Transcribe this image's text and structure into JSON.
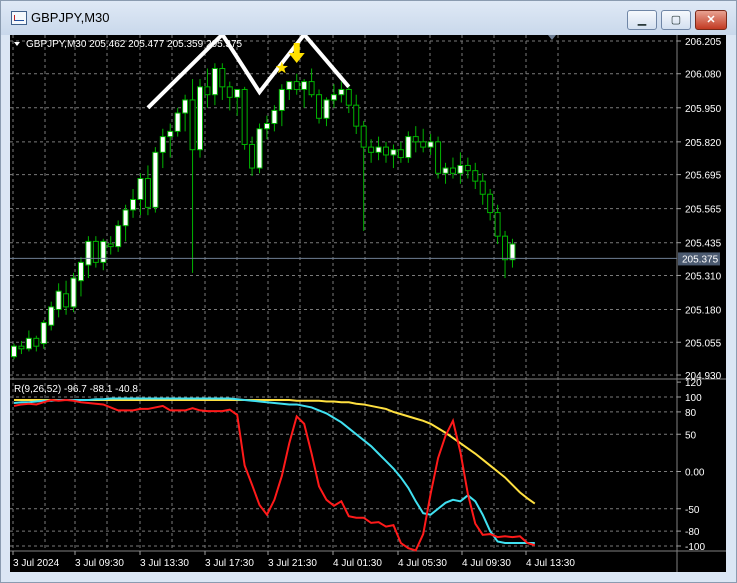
{
  "window": {
    "title": "GBPJPY,M30",
    "minimize_label": "▁",
    "maximize_label": "▢",
    "close_label": "✕"
  },
  "main_chart": {
    "header": "GBPJPY,M30  205.462 205.477 205.359 205.375",
    "price_labels": [
      "206.205",
      "206.080",
      "205.950",
      "205.820",
      "205.695",
      "205.565",
      "205.435",
      "205.310",
      "205.180",
      "205.055",
      "204.930"
    ],
    "current_price_label": "205.375",
    "current_price": 205.375,
    "candles": [
      [
        205.0,
        205.05,
        204.99,
        205.04
      ],
      [
        205.04,
        205.06,
        205.01,
        205.03
      ],
      [
        205.03,
        205.1,
        205.02,
        205.07
      ],
      [
        205.07,
        205.08,
        205.02,
        205.04
      ],
      [
        205.05,
        205.14,
        205.03,
        205.13
      ],
      [
        205.12,
        205.21,
        205.1,
        205.19
      ],
      [
        205.18,
        205.28,
        205.15,
        205.25
      ],
      [
        205.24,
        205.29,
        205.16,
        205.19
      ],
      [
        205.19,
        205.32,
        205.17,
        205.3
      ],
      [
        205.29,
        205.38,
        205.23,
        205.36
      ],
      [
        205.35,
        205.46,
        205.3,
        205.44
      ],
      [
        205.44,
        205.46,
        205.34,
        205.36
      ],
      [
        205.36,
        205.45,
        205.33,
        205.44
      ],
      [
        205.43,
        205.46,
        205.39,
        205.42
      ],
      [
        205.42,
        205.52,
        205.4,
        205.5
      ],
      [
        205.5,
        205.58,
        205.44,
        205.56
      ],
      [
        205.56,
        205.64,
        205.53,
        205.6
      ],
      [
        205.6,
        205.7,
        205.54,
        205.68
      ],
      [
        205.68,
        205.73,
        205.54,
        205.57
      ],
      [
        205.57,
        205.8,
        205.55,
        205.78
      ],
      [
        205.78,
        205.87,
        205.72,
        205.84
      ],
      [
        205.84,
        205.89,
        205.76,
        205.86
      ],
      [
        205.86,
        205.95,
        205.84,
        205.93
      ],
      [
        205.93,
        206.0,
        205.86,
        205.98
      ],
      [
        205.98,
        206.06,
        205.32,
        205.79
      ],
      [
        205.79,
        206.06,
        205.76,
        206.03
      ],
      [
        206.03,
        206.1,
        205.95,
        206.0
      ],
      [
        206.0,
        206.12,
        205.96,
        206.1
      ],
      [
        206.1,
        206.12,
        205.98,
        206.03
      ],
      [
        206.03,
        206.05,
        205.94,
        205.99
      ],
      [
        205.99,
        206.02,
        205.92,
        206.02
      ],
      [
        206.02,
        206.03,
        205.79,
        205.81
      ],
      [
        205.81,
        205.84,
        205.69,
        205.72
      ],
      [
        205.72,
        205.89,
        205.7,
        205.87
      ],
      [
        205.87,
        205.92,
        205.83,
        205.89
      ],
      [
        205.89,
        205.96,
        205.86,
        205.94
      ],
      [
        205.94,
        206.04,
        205.88,
        206.02
      ],
      [
        206.02,
        206.05,
        205.98,
        206.05
      ],
      [
        206.05,
        206.08,
        206.0,
        206.02
      ],
      [
        206.02,
        206.06,
        205.95,
        206.05
      ],
      [
        206.05,
        206.1,
        205.99,
        206.0
      ],
      [
        206.0,
        206.02,
        205.89,
        205.91
      ],
      [
        205.91,
        205.99,
        205.88,
        205.98
      ],
      [
        205.98,
        206.04,
        205.95,
        206.0
      ],
      [
        206.0,
        206.05,
        205.97,
        206.02
      ],
      [
        206.02,
        206.04,
        205.93,
        205.96
      ],
      [
        205.96,
        206.0,
        205.85,
        205.88
      ],
      [
        205.88,
        205.9,
        205.48,
        205.8
      ],
      [
        205.8,
        205.83,
        205.74,
        205.78
      ],
      [
        205.78,
        205.84,
        205.75,
        205.8
      ],
      [
        205.8,
        205.82,
        205.74,
        205.77
      ],
      [
        205.77,
        205.81,
        205.72,
        205.79
      ],
      [
        205.79,
        205.82,
        205.74,
        205.76
      ],
      [
        205.76,
        205.86,
        205.74,
        205.84
      ],
      [
        205.84,
        205.88,
        205.78,
        205.82
      ],
      [
        205.82,
        205.87,
        205.78,
        205.8
      ],
      [
        205.8,
        205.85,
        205.77,
        205.82
      ],
      [
        205.82,
        205.84,
        205.68,
        205.7
      ],
      [
        205.7,
        205.74,
        205.66,
        205.72
      ],
      [
        205.72,
        205.76,
        205.68,
        205.7
      ],
      [
        205.7,
        205.78,
        205.66,
        205.73
      ],
      [
        205.73,
        205.76,
        205.68,
        205.71
      ],
      [
        205.71,
        205.74,
        205.64,
        205.67
      ],
      [
        205.67,
        205.7,
        205.58,
        205.62
      ],
      [
        205.62,
        205.64,
        205.52,
        205.55
      ],
      [
        205.55,
        205.58,
        205.43,
        205.46
      ],
      [
        205.46,
        205.48,
        205.3,
        205.37
      ],
      [
        205.37,
        205.45,
        205.34,
        205.43
      ]
    ],
    "zigzag": [
      [
        18,
        205.95
      ],
      [
        28,
        206.23
      ],
      [
        33,
        206.01
      ],
      [
        39,
        206.23
      ],
      [
        45,
        206.03
      ]
    ],
    "arrow_candle": 38,
    "star_candle": 36
  },
  "oscillator": {
    "header": "R(9,26,52) -96.7 -88.1 -40.8",
    "level_labels": [
      "120",
      "100",
      "80",
      "50",
      "0.00",
      "-50",
      "-80",
      "-100"
    ],
    "red": [
      88,
      90,
      91,
      90,
      93,
      96,
      95,
      96,
      95,
      93,
      92,
      91,
      90,
      86,
      82,
      82,
      82,
      84,
      84,
      86,
      88,
      82,
      82,
      82,
      85,
      82,
      81,
      81,
      81,
      83,
      76,
      8,
      -18,
      -45,
      -58,
      -38,
      -6,
      38,
      74,
      64,
      24,
      -20,
      -38,
      -46,
      -40,
      -60,
      -62,
      -62,
      -69,
      -68,
      -74,
      -72,
      -96,
      -103,
      -106,
      -84,
      -30,
      18,
      48,
      68,
      26,
      -30,
      -70,
      -85,
      -84,
      -88,
      -87,
      -88,
      -87,
      -96,
      -99
    ],
    "cyan": [
      92,
      93,
      93,
      94,
      95,
      95,
      96,
      96,
      96,
      96,
      96,
      97,
      97,
      98,
      98,
      98,
      98,
      98,
      98,
      98,
      98,
      98,
      98,
      98,
      98,
      98,
      98,
      98,
      98,
      98,
      97,
      96,
      95,
      94,
      93,
      92,
      91,
      90,
      90,
      88,
      86,
      82,
      78,
      72,
      66,
      58,
      50,
      42,
      34,
      24,
      14,
      4,
      -8,
      -22,
      -40,
      -56,
      -58,
      -50,
      -42,
      -38,
      -40,
      -32,
      -40,
      -58,
      -80,
      -94,
      -96,
      -96,
      -96,
      -96,
      -96
    ],
    "yellow": [
      96,
      96,
      96,
      96,
      96,
      96,
      96,
      96,
      96,
      96,
      96,
      96,
      96,
      96,
      96,
      96,
      96,
      96,
      96,
      96,
      96,
      96,
      96,
      96,
      96,
      96,
      96,
      96,
      96,
      96,
      96,
      96,
      96,
      96,
      96,
      96,
      96,
      96,
      95,
      95,
      95,
      95,
      94,
      94,
      93,
      93,
      91,
      90,
      88,
      86,
      84,
      80,
      77,
      74,
      71,
      68,
      64,
      58,
      52,
      45,
      38,
      31,
      24,
      16,
      8,
      0,
      -8,
      -18,
      -28,
      -36,
      -43
    ]
  },
  "time_labels": [
    "3 Jul 2024",
    "3 Jul 09:30",
    "3 Jul 13:30",
    "3 Jul 17:30",
    "3 Jul 21:30",
    "4 Jul 01:30",
    "4 Jul 05:30",
    "4 Jul 09:30",
    "4 Jul 13:30"
  ],
  "colors": {
    "bull": "#ffffff",
    "bear": "#000000",
    "wick": "#00b400",
    "zigzag": "#ffffff",
    "arrow": "#ffe000",
    "star": "#ffe000",
    "red": "#ff1a1a",
    "cyan": "#40e0f0",
    "yellow": "#ffe040"
  }
}
